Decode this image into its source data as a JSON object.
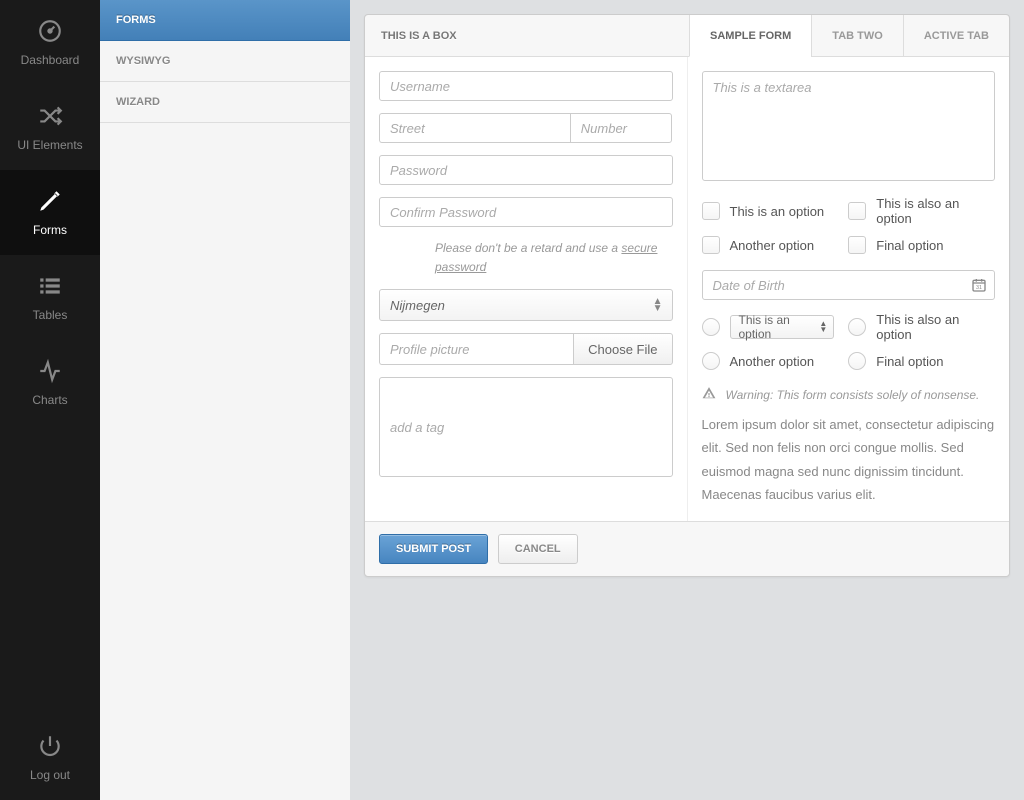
{
  "mainNav": {
    "items": [
      {
        "label": "Dashboard"
      },
      {
        "label": "UI Elements"
      },
      {
        "label": "Forms"
      },
      {
        "label": "Tables"
      },
      {
        "label": "Charts"
      }
    ],
    "logout": "Log out"
  },
  "subNav": {
    "items": [
      {
        "label": "Forms"
      },
      {
        "label": "WYSIWYG"
      },
      {
        "label": "Wizard"
      }
    ]
  },
  "box": {
    "title": "This is a box",
    "tabs": [
      {
        "label": "Sample Form"
      },
      {
        "label": "Tab Two"
      },
      {
        "label": "Active Tab"
      }
    ]
  },
  "form": {
    "username_ph": "Username",
    "street_ph": "Street",
    "number_ph": "Number",
    "password_ph": "Password",
    "confirm_ph": "Confirm Password",
    "help_pre": "Please don't be a retard and use a ",
    "help_link": "secure password",
    "select_value": "Nijmegen",
    "profile_ph": "Profile picture",
    "choose_file": "Choose File",
    "tag_ph": "add a tag",
    "textarea_ph": "This is a textarea",
    "checks": [
      "This is an option",
      "This is also an option",
      "Another option",
      "Final option"
    ],
    "dob_ph": "Date of Birth",
    "radio_select": "This is an option",
    "radios": [
      "This is also an option",
      "Another option",
      "Final option"
    ],
    "warning": "Warning: This form consists solely of nonsense.",
    "lorem": "Lorem ipsum dolor sit amet, consectetur adipiscing elit. Sed non felis non orci congue mollis. Sed euismod magna sed nunc dignissim tincidunt. Maecenas faucibus varius elit.",
    "submit": "Submit Post",
    "cancel": "Cancel"
  }
}
